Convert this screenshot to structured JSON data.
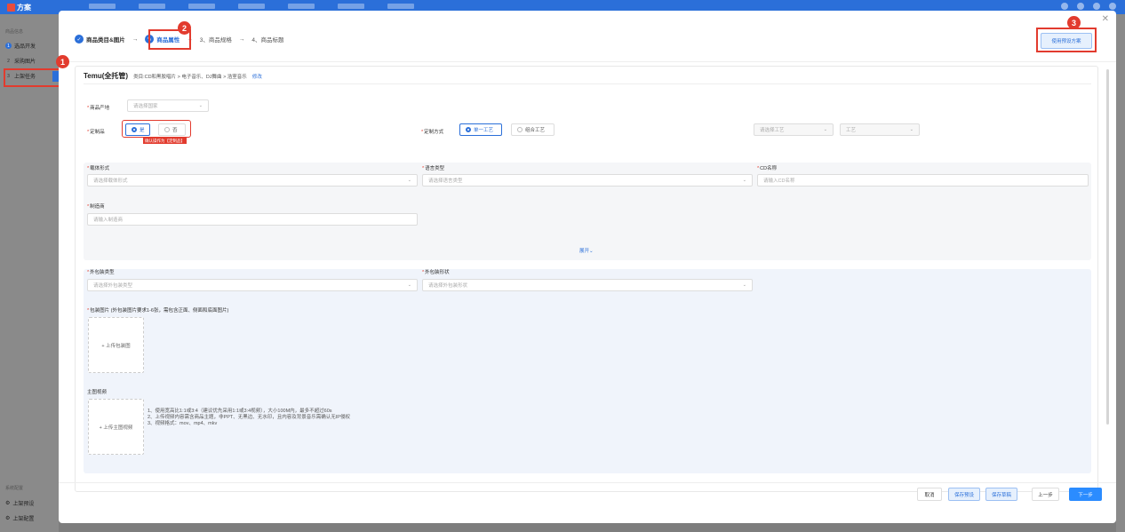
{
  "topbar": {
    "logo": "方案"
  },
  "sidebar": {
    "section1": "商品信息",
    "items": [
      {
        "num": "1",
        "label": "选品开发"
      },
      {
        "num": "2",
        "label": "采购图片"
      },
      {
        "num": "3",
        "label": "上架任务"
      }
    ],
    "section2": "系统配置",
    "bottom_items": [
      {
        "label": "上架预设"
      },
      {
        "label": "上架配置"
      }
    ]
  },
  "badges": [
    "1",
    "2",
    "3"
  ],
  "steps": [
    {
      "label": "商品类目&图片",
      "state": "done"
    },
    {
      "label": "商品属性",
      "state": "active"
    },
    {
      "label": "3、商品规格",
      "state": "todo"
    },
    {
      "label": "4、商品标题",
      "state": "todo"
    }
  ],
  "preset_button": "使用预设方案",
  "shop": {
    "title": "Temu(全托管)",
    "category": "类目:CD和黑胶唱片 > 电子音乐、DJ舞曲 > 浩室音乐",
    "edit": "修改"
  },
  "form": {
    "origin": {
      "label": "商品产地",
      "placeholder": "请选择国家"
    },
    "customized": {
      "label": "定制品",
      "yes": "是",
      "no": "否",
      "tag": "确认操作为【定制品】"
    },
    "craft": {
      "label": "定制方式",
      "single": "单一工艺",
      "combo": "组合工艺",
      "craft_select": "请选择工艺",
      "craft_sub": "工艺"
    },
    "carrier": {
      "label": "载体形式",
      "placeholder": "请选择载体形式"
    },
    "language": {
      "label": "语言类型",
      "placeholder": "请选择语言类型"
    },
    "cd_name": {
      "label": "CD名称",
      "placeholder": "请输入CD名称"
    },
    "maker": {
      "label": "制造商",
      "placeholder": "请输入制造商"
    },
    "expand": "展开",
    "pack_type": {
      "label": "外包装类型",
      "placeholder": "请选择外包装类型"
    },
    "pack_shape": {
      "label": "外包装形状",
      "placeholder": "请选择外包装形状"
    },
    "pack_images": {
      "label": "包装图片 (外包装图片要求1-6张，需包含正面、侧面和底面图片)",
      "upload": "+ 上传包装图"
    },
    "main_video": {
      "label": "主图视频",
      "upload": "+ 上传主图视频",
      "notes": [
        "1、使用宽高比1:1或3:4（建议优先采用1:1或3:4视频），大小100M内，最多不超过60s",
        "2、上传视频内容需含商品主题，非PPT、无黑边、无水印，且内容及背景音乐需确认无IP侵权",
        "3、视频格式：mov、mp4、mkv"
      ]
    }
  },
  "footer": {
    "cancel": "取消",
    "save_preset": "保存预设",
    "save_draft": "保存草稿",
    "prev": "上一步",
    "next": "下一步"
  }
}
